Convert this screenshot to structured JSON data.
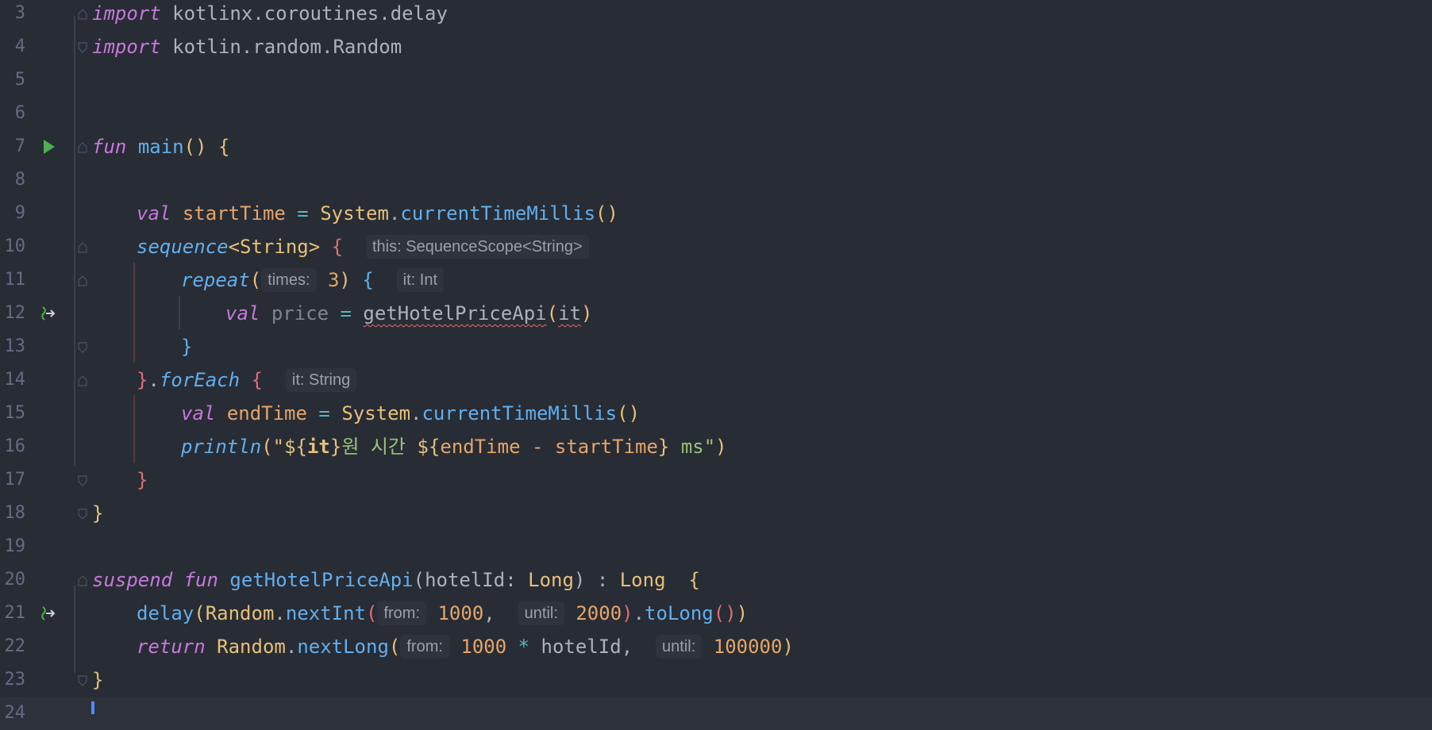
{
  "editor": {
    "language": "Kotlin",
    "lines": [
      {
        "num": "3",
        "tokens": [
          "import",
          " kotlinx.coroutines.delay"
        ]
      },
      {
        "num": "4",
        "tokens": [
          "import",
          " kotlin.random.Random"
        ]
      },
      {
        "num": "5"
      },
      {
        "num": "6"
      },
      {
        "num": "7",
        "tokens": [
          "fun",
          " ",
          "main",
          "()",
          " ",
          "{"
        ]
      },
      {
        "num": "8"
      },
      {
        "num": "9",
        "tokens": [
          "val",
          " ",
          "startTime",
          " = ",
          "System",
          ".",
          "currentTimeMillis",
          "()"
        ]
      },
      {
        "num": "10",
        "tokens": [
          "sequence",
          "<String>",
          " ",
          "{"
        ],
        "hint": "this: SequenceScope<String>"
      },
      {
        "num": "11",
        "tokens": [
          "repeat",
          "(",
          "times:",
          "3",
          ")",
          " ",
          "{"
        ],
        "hint": "it: Int"
      },
      {
        "num": "12",
        "tokens": [
          "val",
          " ",
          "price",
          " = ",
          "getHotelPriceApi",
          "(",
          "it",
          ")"
        ]
      },
      {
        "num": "13",
        "tokens": [
          "}"
        ]
      },
      {
        "num": "14",
        "tokens": [
          "}",
          ".",
          "forEach",
          " ",
          "{"
        ],
        "hint": "it: String"
      },
      {
        "num": "15",
        "tokens": [
          "val",
          " ",
          "endTime",
          " = ",
          "System",
          ".",
          "currentTimeMillis",
          "()"
        ]
      },
      {
        "num": "16",
        "tokens": [
          "println",
          "(\"",
          "${",
          "it",
          "}",
          "원 시간 ",
          "${",
          "endTime - startTime",
          "}",
          " ms\"",
          ")"
        ]
      },
      {
        "num": "17",
        "tokens": [
          "}"
        ]
      },
      {
        "num": "18",
        "tokens": [
          "}"
        ]
      },
      {
        "num": "19"
      },
      {
        "num": "20",
        "tokens": [
          "suspend",
          " ",
          "fun",
          " ",
          "getHotelPriceApi",
          "(",
          "hotelId",
          ": ",
          "Long",
          ") : ",
          "Long",
          "  ",
          "{"
        ]
      },
      {
        "num": "21",
        "tokens": [
          "delay",
          "(",
          "Random",
          ".",
          "nextInt",
          "(",
          "from:",
          "1000",
          ",",
          "until:",
          "2000",
          ")",
          ".",
          "toLong",
          "()",
          ")"
        ]
      },
      {
        "num": "22",
        "tokens": [
          "return",
          " ",
          "Random",
          ".",
          "nextLong",
          "(",
          "from:",
          "1000",
          " * ",
          "hotelId",
          ",",
          "until:",
          "100000",
          ")"
        ]
      },
      {
        "num": "23",
        "tokens": [
          "}"
        ]
      },
      {
        "num": "24"
      }
    ]
  },
  "colors": {
    "background": "#282c34",
    "keyword": "#c678dd",
    "function": "#61afef",
    "type": "#e5c07b",
    "number": "#e5a56b",
    "string": "#98c379",
    "brace_red": "#e06c75",
    "line_number": "#636d83",
    "run_icon": "#4caf50"
  }
}
